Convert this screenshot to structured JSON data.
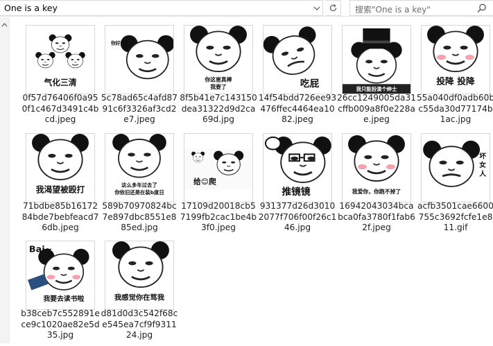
{
  "window": {
    "address": "One is a key",
    "search_placeholder": "搜索\"One is a key\""
  },
  "icons": {
    "address_dropdown": "chevron-down-icon",
    "refresh": "refresh-icon",
    "search": "search-icon",
    "nav_up": "chevron-up-icon"
  },
  "files": [
    {
      "name": "0f57d76406f0a950f1c467d3491c4bcd.jpeg",
      "caption": "气化三清"
    },
    {
      "name": "5c78ad65c4afd8791c6f3326af3cd2e7.jpeg",
      "caption": "你好好好"
    },
    {
      "name": "8f5b41e7c143150dea31322d9d2ca69d.jpg",
      "caption": "你这崽真棒 我要了"
    },
    {
      "name": "14f54bdd726ee93476ffec4464ea1082.jpeg",
      "caption": "吃屁"
    },
    {
      "name": "26cc1249005da31cffb009a8f0e228ae.jpeg",
      "caption": "我只能扮演个绅士"
    },
    {
      "name": "55a040df0adb60bc55da30d77174b1ac.jpg",
      "caption": "投降 投降"
    },
    {
      "name": "71bdbe85b1617284bde7bebfeacd76db.jpeg",
      "caption": "我渴望被殴打"
    },
    {
      "name": "589b70970824bc7e897dbc8551e885ed.jpg",
      "caption": "这么多年过去了 你依旧还是在装b度日"
    },
    {
      "name": "17109d20018cb57199fb2cac1be4b3f0.jpeg",
      "caption": "给😊爬"
    },
    {
      "name": "931377d26d30102077f706f00f26c146.jpg",
      "caption": "推镜镜"
    },
    {
      "name": "16942043034bcabca0fa3780f1fab62f.jpeg",
      "caption": "我爱你，你跑不掉了"
    },
    {
      "name": "acfb3501cae6600755c3692fcfe1e811.gif",
      "caption": "坏女人"
    },
    {
      "name": "b38ceb7c552891ece9c1020ae82e5d35.jpg",
      "caption": "我要去读书啦"
    },
    {
      "name": "d81d0d3c542f68ce545ea7cf9f931124.jpg",
      "caption": "我感觉你在骂我"
    }
  ],
  "extras": {
    "bai_text": "Bai~"
  }
}
